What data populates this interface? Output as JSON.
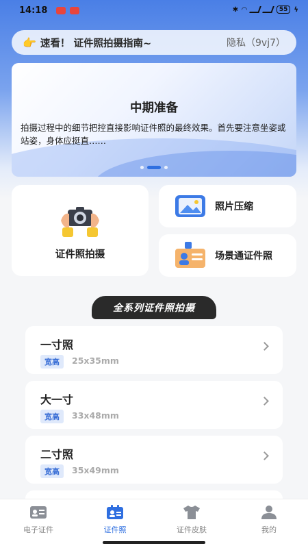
{
  "status_bar": {
    "time": "14:18",
    "battery": "55"
  },
  "notice": {
    "icon": "👉",
    "title": "速看！ 证件照拍摄指南~",
    "privacy": "隐私（9vj7）"
  },
  "banner": {
    "title": "中期准备",
    "text": "拍摄过程中的细节把控直接影响证件照的最终效果。首先要注意坐姿或站姿，身体应挺直……"
  },
  "features": {
    "main": "证件照拍摄",
    "compress": "照片压缩",
    "scene": "场景通证件照"
  },
  "section_title": "全系列证件照拍摄",
  "list": [
    {
      "name": "一寸照",
      "tag": "宽高",
      "size": "25x35mm"
    },
    {
      "name": "大一寸",
      "tag": "宽高",
      "size": "33x48mm"
    },
    {
      "name": "二寸照",
      "tag": "宽高",
      "size": "35x49mm"
    }
  ],
  "nav": [
    {
      "label": "电子证件",
      "icon": "id-card-icon"
    },
    {
      "label": "证件照",
      "icon": "photo-id-icon",
      "active": true
    },
    {
      "label": "证件皮肤",
      "icon": "shirt-icon"
    },
    {
      "label": "我的",
      "icon": "user-icon"
    }
  ],
  "colors": {
    "accent": "#2f6fe0",
    "header": "#4a7fe6"
  }
}
